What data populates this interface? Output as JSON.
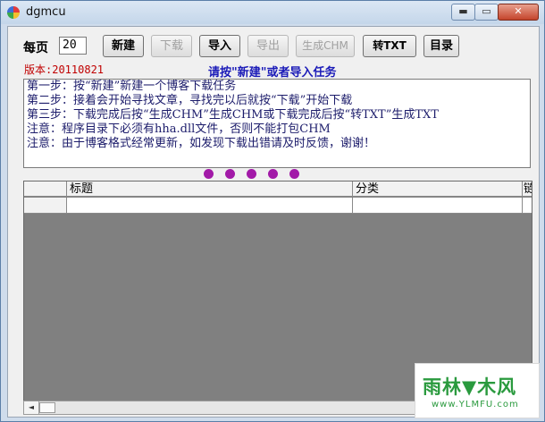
{
  "window": {
    "title": "dgmcu",
    "min_glyph": "▬",
    "max_glyph": "▭",
    "close_glyph": "✕"
  },
  "toolbar": {
    "per_page_label": "每页",
    "per_page_value": "20",
    "buttons": {
      "new": "新建",
      "download": "下载",
      "import": "导入",
      "export": "导出",
      "chm": "生成CHM",
      "txt": "转TXT",
      "catalog": "目录"
    }
  },
  "version": "版本:20110821",
  "hint": "请按\"新建\"或者导入任务",
  "instructions": [
    "第一步：按“新建”新建一个博客下载任务",
    "第二步：接着会开始寻找文章，寻找完以后就按“下载”开始下载",
    "第三步：下载完成后按“生成CHM”生成CHM或下载完成后按“转TXT”生成TXT",
    "注意：程序目录下必须有hha.dll文件，否则不能打包CHM",
    "注意：由于博客格式经常更新，如发现下载出错请及时反馈，谢谢！"
  ],
  "grid": {
    "columns": [
      "",
      "标题",
      "分类",
      "链"
    ]
  },
  "watermark": {
    "main": "雨林▼木风",
    "sub": "www.YLMFU.com"
  },
  "colors": {
    "hint": "#1b1bb8",
    "version": "#c00000",
    "dots": "#a21aa8",
    "grid_bg": "#808080"
  }
}
